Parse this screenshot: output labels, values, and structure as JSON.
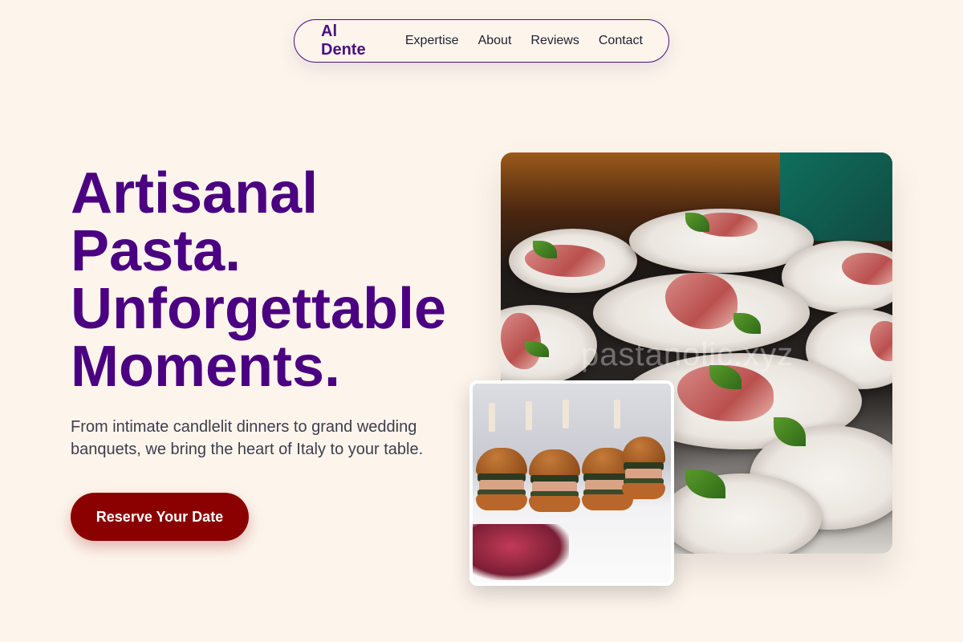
{
  "nav": {
    "brand": "Al Dente",
    "links": [
      "Expertise",
      "About",
      "Reviews",
      "Contact"
    ]
  },
  "hero": {
    "title_lines": [
      "Artisanal",
      "Pasta.",
      "Unforgettable",
      "Moments."
    ],
    "subtitle": "From intimate candlelit dinners to grand wedding banquets, we bring the heart of Italy to your table.",
    "cta_label": "Reserve Your Date"
  },
  "images": {
    "main_watermark": "pastanolic.xyz"
  },
  "colors": {
    "background": "#fdf5ec",
    "brand_purple": "#4b0082",
    "cta_red": "#8b0000"
  }
}
